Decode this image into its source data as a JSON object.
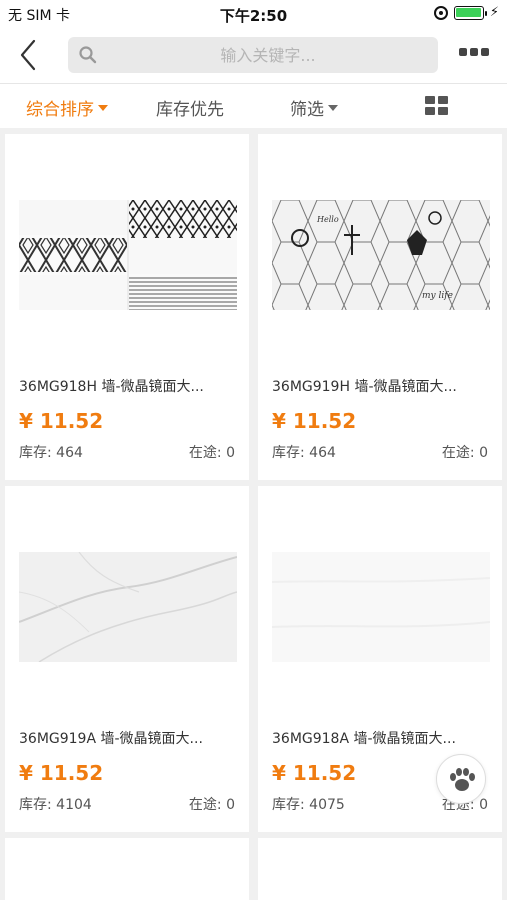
{
  "status_bar": {
    "carrier": "无 SIM 卡",
    "time": "下午2:50",
    "battery_level": 1.0
  },
  "nav": {
    "search_placeholder": "输入关键字..."
  },
  "filters": {
    "sort_label": "综合排序",
    "stock_label": "库存优先",
    "filter_label": "筛选"
  },
  "accent_color": "#f07c10",
  "products": [
    {
      "name": "36MG918H 墙-微晶镜面大...",
      "price": "¥ 11.52",
      "stock": "库存: 464",
      "in_transit": "在途: 0",
      "image": "geometric-pattern-tile"
    },
    {
      "name": "36MG919H 墙-微晶镜面大...",
      "price": "¥ 11.52",
      "stock": "库存: 464",
      "in_transit": "在途: 0",
      "image": "hexagon-decor-tile"
    },
    {
      "name": "36MG919A 墙-微晶镜面大...",
      "price": "¥ 11.52",
      "stock": "库存: 4104",
      "in_transit": "在途: 0",
      "image": "marble-tile"
    },
    {
      "name": "36MG918A 墙-微晶镜面大...",
      "price": "¥ 11.52",
      "stock": "库存: 4075",
      "in_transit": "在途: 0",
      "image": "white-tile"
    }
  ],
  "floating_button": {
    "icon": "paw-icon"
  }
}
